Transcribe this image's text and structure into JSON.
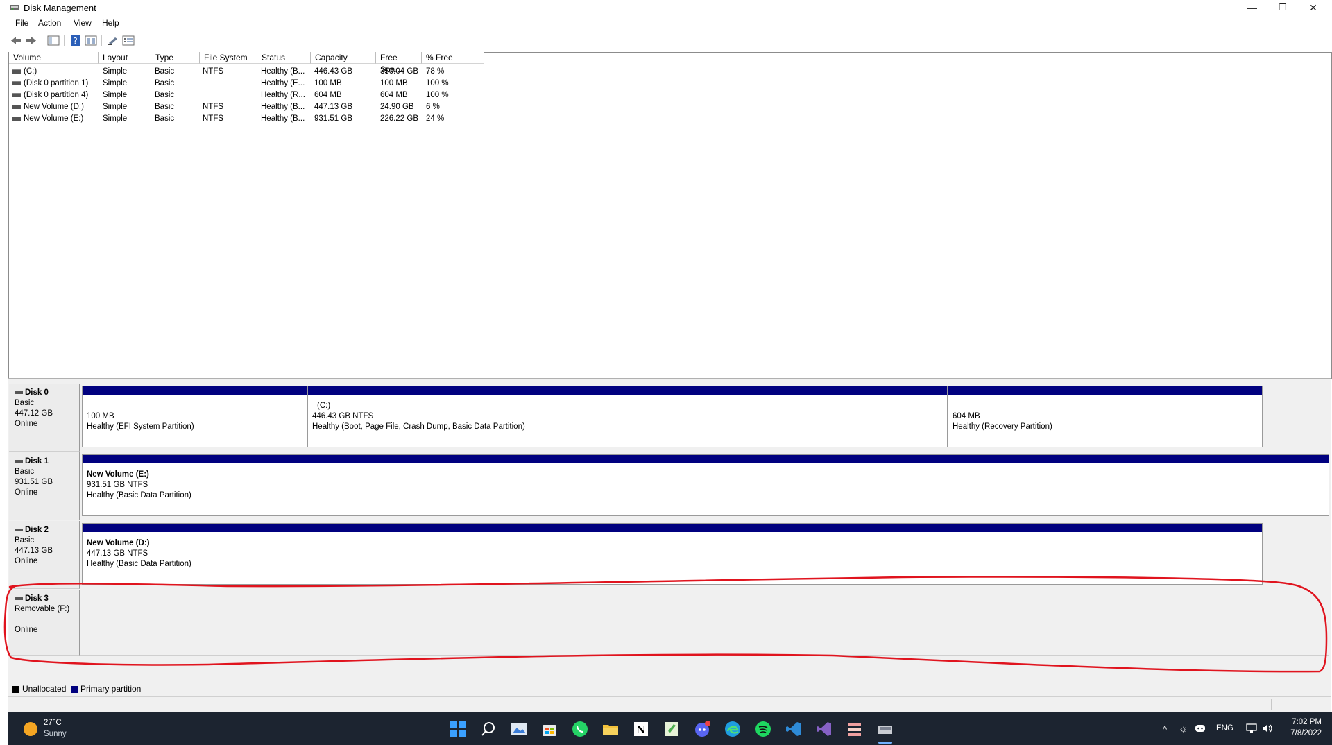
{
  "window": {
    "title": "Disk Management",
    "minimize_glyph": "—",
    "maximize_glyph": "❐",
    "close_glyph": "✕"
  },
  "menu": [
    "File",
    "Action",
    "View",
    "Help"
  ],
  "toolbar_icons": [
    "back-icon",
    "forward-icon",
    "show-hide-console-tree-icon",
    "help-icon",
    "properties-icon",
    "connect-icon",
    "list-view-icon"
  ],
  "volume_list": {
    "columns": [
      "Volume",
      "Layout",
      "Type",
      "File System",
      "Status",
      "Capacity",
      "Free Spa...",
      "% Free"
    ],
    "rows": [
      [
        "(C:)",
        "Simple",
        "Basic",
        "NTFS",
        "Healthy (B...",
        "446.43 GB",
        "350.04 GB",
        "78 %"
      ],
      [
        "(Disk 0 partition 1)",
        "Simple",
        "Basic",
        "",
        "Healthy (E...",
        "100 MB",
        "100 MB",
        "100 %"
      ],
      [
        "(Disk 0 partition 4)",
        "Simple",
        "Basic",
        "",
        "Healthy (R...",
        "604 MB",
        "604 MB",
        "100 %"
      ],
      [
        "New Volume (D:)",
        "Simple",
        "Basic",
        "NTFS",
        "Healthy (B...",
        "447.13 GB",
        "24.90 GB",
        "6 %"
      ],
      [
        "New Volume (E:)",
        "Simple",
        "Basic",
        "NTFS",
        "Healthy (B...",
        "931.51 GB",
        "226.22 GB",
        "24 %"
      ]
    ]
  },
  "disks": [
    {
      "name": "Disk 0",
      "type": "Basic",
      "size": "447.12 GB",
      "status": "Online",
      "partitions": [
        {
          "label": "",
          "size": "100 MB",
          "status": "Healthy (EFI System Partition)"
        },
        {
          "label": "(C:)",
          "size": "446.43 GB NTFS",
          "status": "Healthy (Boot, Page File, Crash Dump, Basic Data Partition)"
        },
        {
          "label": "",
          "size": "604 MB",
          "status": "Healthy (Recovery Partition)"
        }
      ]
    },
    {
      "name": "Disk 1",
      "type": "Basic",
      "size": "931.51 GB",
      "status": "Online",
      "partitions": [
        {
          "label": "New Volume  (E:)",
          "size": "931.51 GB NTFS",
          "status": "Healthy (Basic Data Partition)"
        }
      ]
    },
    {
      "name": "Disk 2",
      "type": "Basic",
      "size": "447.13 GB",
      "status": "Online",
      "partitions": [
        {
          "label": "New Volume  (D:)",
          "size": "447.13 GB NTFS",
          "status": "Healthy (Basic Data Partition)"
        }
      ]
    },
    {
      "name": "Disk 3",
      "type": "Removable (F:)",
      "size": "",
      "status": "Online",
      "partitions": []
    }
  ],
  "legend": [
    {
      "label": "Unallocated",
      "color": "#000000"
    },
    {
      "label": "Primary partition",
      "color": "#00007f"
    }
  ],
  "taskbar": {
    "weather_temp": "27°C",
    "weather_desc": "Sunny",
    "apps": [
      "windows-start-icon",
      "search-icon",
      "photos-icon",
      "store-icon",
      "whatsapp-icon",
      "file-explorer-icon",
      "notion-icon",
      "notepad-icon",
      "discord-icon",
      "edge-icon",
      "spotify-icon",
      "vscode-icon",
      "visual-studio-icon",
      "stack-app-icon",
      "disk-management-icon"
    ],
    "tray_lang": "ENG",
    "time": "7:02 PM",
    "date": "7/8/2022"
  },
  "colors": {
    "primary_partition": "#00007f",
    "annotation": "#e0141e",
    "taskbar": "#1c2430"
  }
}
